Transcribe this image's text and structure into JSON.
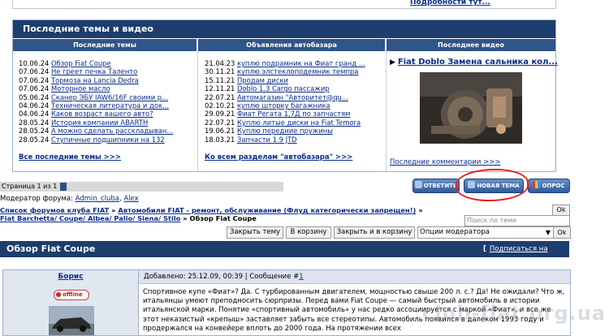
{
  "top": {
    "link": "Подробности тут..."
  },
  "latest": {
    "title": "Последние темы и видео",
    "columns": {
      "topics": "Последние темы",
      "ads": "Объявления автобазара",
      "video": "Последнее видео"
    },
    "topics": [
      {
        "date": "10.06.24",
        "title": "Обзор Fiat Coupe"
      },
      {
        "date": "07.06.24",
        "title": "Не греет печка Таленто"
      },
      {
        "date": "07.06.24",
        "title": "Тормоза на Lancia Dedra"
      },
      {
        "date": "07.06.24",
        "title": "Моторное масло"
      },
      {
        "date": "05.06.24",
        "title": "Сканер ЭБУ IAW6/16F своими р..."
      },
      {
        "date": "04.06.24",
        "title": "Техническая литература и док..."
      },
      {
        "date": "04.06.24",
        "title": "Каков возраст вашего авто?"
      },
      {
        "date": "28.05.24",
        "title": "История компании ABARTH"
      },
      {
        "date": "28.05.24",
        "title": "А можно сделать расскладыван..."
      },
      {
        "date": "28.05.24",
        "title": "Ступичные подшипники на 132"
      }
    ],
    "ads": [
      {
        "date": "21.04.23",
        "title": "куплю подрамник на Фиат гранд ..."
      },
      {
        "date": "30.11.21",
        "title": "куплю элстеклоподемник темпра"
      },
      {
        "date": "15.11.21",
        "title": "Продам диски"
      },
      {
        "date": "12.11.21",
        "title": "Doblo 1.3 Cargo пассажир"
      },
      {
        "date": "22.07.21",
        "title": "Автомагазин \"Автоpитет@qu..."
      },
      {
        "date": "02.10.21",
        "title": "куплю шторку багажника"
      },
      {
        "date": "29.09.21",
        "title": "Фиат Регата 1,7Д по запчастям"
      },
      {
        "date": "22.07.21",
        "title": "Куплю литые диски на Fiat Temora"
      },
      {
        "date": "19.06.21",
        "title": "Куплю передние пружины"
      },
      {
        "date": "18.03.21",
        "title": "Запчасти 1.9 JTD"
      }
    ],
    "all_topics": "Все последние темы >>>",
    "all_ads": "Ко всем разделам \"автобазара\" >>>",
    "video_title": "Fiat Doblo Замена сальника кол...",
    "video_comments": "Последние комментарии >>>"
  },
  "pager": {
    "label": "Страница 1 из 1"
  },
  "buttons": {
    "reply": "ОТВЕТИТЬ",
    "new_topic": "НОВАЯ ТЕМА",
    "poll": "ОПРОС"
  },
  "moderator": {
    "label": "Модератор форума:",
    "names": [
      "Admin_cluba",
      "Alex"
    ],
    "sep": ","
  },
  "breadcrumb": {
    "items": [
      "Список форумов клуба FIAT",
      "Автомобили FIAT - ремонт, обслуживание (Флуд категорически запрещен!)",
      "Fiat Barchetta/ Coupe/ Albea/ Palio/ Siena/ Stilo"
    ],
    "sep": " » ",
    "current": "Обзор Fiat Coupe"
  },
  "search": {
    "placeholder": "Поиск по теме",
    "ok": "Ok"
  },
  "actions": {
    "close": "Закрыть тему",
    "trash": "В корзину",
    "close_trash": "Закрыть и в корзину",
    "mod_options": "Опции модератора",
    "ok": "Ok"
  },
  "topic": {
    "title": "Обзор Fiat Coupe",
    "subscribe": "Подписаться на тему",
    "bracket_open": "[",
    "bracket_close": "]"
  },
  "post": {
    "author": "Борис",
    "status": "offline",
    "meta_prefix": "Добавлено: 25.12.09, 00:39 | Сообщение #",
    "number": "1",
    "body": "Спортивное купе «Фиат»? Да. С турбированным двигателем, мощностью свыше 200 л. с.? Да! Не ожидали? Что ж, итальянцы умеют преподносить сюрпризы. Перед вами Fiat Coupe — самый быстрый автомобиль в истории итальянской марки. Понятие «спортивный автомобиль» у нас редко ассоциируется с маркой «Фиат», и все же этот неказистый «крепыш» заставляет забыть все стереотипы. Автомобиль появился в далеком 1993 году и продержался на конвейере вплоть до 2000 года. На протяжении всех"
  },
  "watermark": "club-fiat.org.ua"
}
